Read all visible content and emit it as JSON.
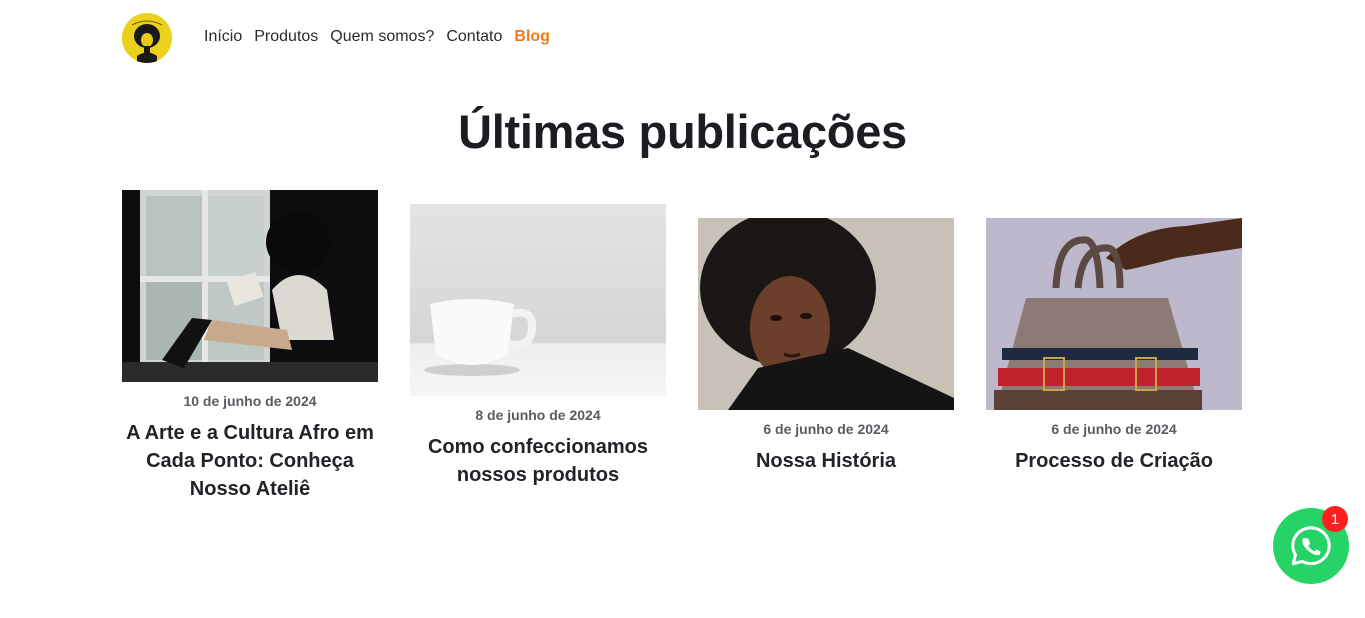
{
  "brand": {
    "logo_icon": "afro-woman-logo-icon"
  },
  "nav": [
    {
      "label": "Início"
    },
    {
      "label": "Produtos"
    },
    {
      "label": "Quem somos?"
    },
    {
      "label": "Contato"
    },
    {
      "label": "Blog",
      "active": true
    }
  ],
  "colors": {
    "accent": "#f07b17",
    "whatsapp": "#25d366",
    "badge": "#ff1f1f"
  },
  "heading": "Últimas publicações",
  "posts": [
    {
      "date": "10 de junho de 2024",
      "title": "A Arte e a Cultura Afro em Cada Ponto: Conheça Nosso Ateliê",
      "image": "woman-reading-by-window-image"
    },
    {
      "date": "8 de junho de 2024",
      "title": "Como confeccionamos nossos produtos",
      "image": "white-mug-image"
    },
    {
      "date": "6 de junho de 2024",
      "title": "Nossa História",
      "image": "woman-portrait-image"
    },
    {
      "date": "6 de junho de 2024",
      "title": "Processo de Criação",
      "image": "hand-holding-bag-image"
    }
  ],
  "whatsapp": {
    "icon": "whatsapp-icon",
    "badge_count": "1"
  }
}
